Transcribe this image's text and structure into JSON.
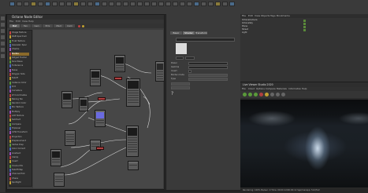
{
  "app": {
    "title": "Cinema 4D R23"
  },
  "top_menu": [
    "File",
    "Edit",
    "Create",
    "Modes",
    "Select",
    "Tools",
    "Spline",
    "Mesh",
    "Volume",
    "MoGraph",
    "Character",
    "Animate",
    "Simulate",
    "Tracker",
    "Render",
    "Extensions",
    "Window",
    "Help"
  ],
  "node_editor": {
    "title": "Octane Node Editor",
    "menu": [
      "File",
      "Edit",
      "View",
      "Help"
    ],
    "tabs": [
      "Mat",
      "Tex",
      "Gen",
      "Emi",
      "Med",
      "Cam"
    ],
    "library": [
      "Image Texture",
      "RGB Spectrum",
      "Float Texture",
      "Gaussian Spec",
      "Checks",
      "Marble",
      "Ridged Fractal",
      "Sine Wave",
      "Turbulence",
      "Noise",
      "Polygon Side",
      "Falloff",
      "Instance Color",
      "Dirt",
      "Curvature",
      "W Coordinates",
      "Baking Tex",
      "Random Color",
      "Mix Texture",
      "Multiply",
      "Add Texture",
      "Subtract",
      "Compare",
      "Triplanar",
      "UVW Transform",
      "Projection",
      "Displacement",
      "Vertex Disp",
      "Color Correct",
      "Gradient",
      "Clamp",
      "Invert",
      "Cosine Mix",
      "Falloff Map",
      "Channel Pick",
      "Chaos",
      "Spotlight"
    ]
  },
  "attributes": {
    "tabs": [
      "Basic",
      "Shader",
      "Transform"
    ],
    "rows": [
      {
        "label": "Texture",
        "value": ""
      },
      {
        "label": "Power",
        "value": "1."
      },
      {
        "label": "Gamma",
        "value": "2.2"
      },
      {
        "label": "Invert",
        "value": ""
      },
      {
        "label": "Border mode",
        "value": "Wrap around"
      },
      {
        "label": "Type",
        "value": "Float"
      },
      {
        "label": "Transform",
        "value": ""
      },
      {
        "label": "Projection",
        "value": ""
      }
    ]
  },
  "object_manager": {
    "menu": [
      "File",
      "Edit",
      "View",
      "Objects",
      "Tags",
      "Bookmarks"
    ],
    "objects": [
      "OctaneCamera",
      "OctaneSky",
      "Plane",
      "Street",
      "Light"
    ]
  },
  "render_view": {
    "title": "Live Viewer Studio 2020",
    "menu": [
      "File",
      "Cloud",
      "Options",
      "Compare",
      "Materials",
      "Information",
      "Help"
    ],
    "status": "Rendering: 100%  Ms/sec: 0  Time: 00:00:12/00:00:12  Spp/maxspp: 512/512"
  },
  "colors": {
    "selected_item": "#8a6a2a",
    "red_node": "#b04040",
    "accent": "#4a6a8a"
  }
}
